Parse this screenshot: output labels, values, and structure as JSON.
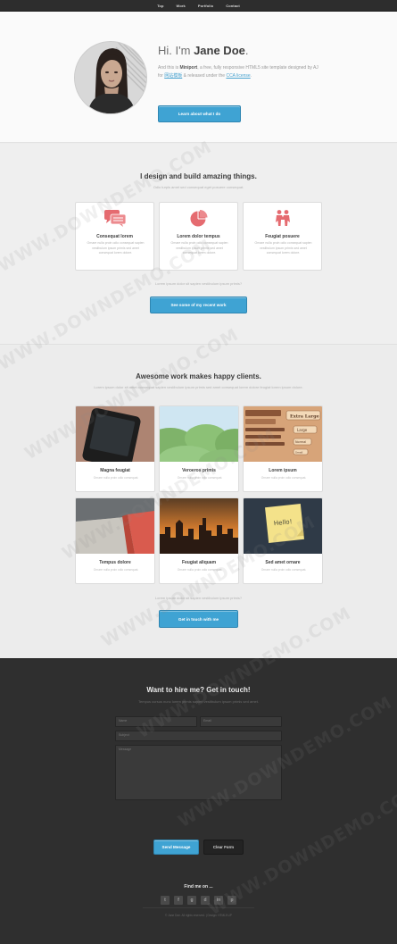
{
  "nav": {
    "items": [
      "Top",
      "Work",
      "Portfolio",
      "Contact"
    ]
  },
  "hero": {
    "greeting": "Hi. I'm",
    "name": "Jane Doe",
    "period": ".",
    "text_pre": "And this is",
    "brand": "Miniport",
    "text_mid": ", a free, fully responsive HTML5 site template designed by AJ for",
    "link1": "网站模板",
    "text_post": "& released under the",
    "link2": "CCA license",
    "text_end": ".",
    "button": "Learn about what I do"
  },
  "services": {
    "title": "I design and build amazing things.",
    "subtitle": "Odio turpis amet sed consequat eget posuere consequat.",
    "items": [
      {
        "icon": "comments-icon",
        "name": "Consequat lorem",
        "desc": "Ornare nulla proin odio consequat sapien vestibulum ipsum primis sed amet consequat lorem dolore."
      },
      {
        "icon": "pie-chart-icon",
        "name": "Lorem dolor tempus",
        "desc": "Ornare nulla proin odio consequat sapien vestibulum ipsum primis sed amet consequat lorem dolore."
      },
      {
        "icon": "people-icon",
        "name": "Feugiat posuere",
        "desc": "Ornare nulla proin odio consequat sapien vestibulum ipsum primis sed amet consequat lorem dolore."
      }
    ],
    "note": "Lorem ipsum dolor sit sapien vestibulum ipsum primis?",
    "button": "See some of my recent work"
  },
  "portfolio": {
    "title": "Awesome work makes happy clients.",
    "subtitle": "Lorem ipsum dolor sit amet consequat sapien vestibulum ipsum primis sed amet consequat lorem dolore feugiat lorem ipsum dolore.",
    "items": [
      {
        "title": "Magna feugiat",
        "desc": "Ornare nulla proin odio consequat."
      },
      {
        "title": "Veroeros primis",
        "desc": "Ornare nulla proin odio consequat."
      },
      {
        "title": "Lorem ipsum",
        "desc": "Ornare nulla proin odio consequat."
      },
      {
        "title": "Tempus dolore",
        "desc": "Ornare nulla proin odio consequat."
      },
      {
        "title": "Feugiat aliquam",
        "desc": "Ornare nulla proin odio consequat."
      },
      {
        "title": "Sed amet ornare",
        "desc": "Ornare nulla proin odio consequat."
      }
    ],
    "thumb3_labels": [
      "Extra Large",
      "Large",
      "Normal",
      "Small"
    ],
    "thumb6_label": "Hello!",
    "note": "Lorem ipsum dolor sit sapien vestibulum ipsum primis?",
    "button": "Get in touch with me"
  },
  "contact": {
    "title": "Want to hire me? Get in touch!",
    "subtitle": "Tempus cursus nunc lorem primis sapien vestibulum ipsum primis sed amet.",
    "name_placeholder": "Name",
    "email_placeholder": "Email",
    "subject_placeholder": "Subject",
    "message_placeholder": "Message",
    "send": "Send Message",
    "clear": "Clear Form",
    "find_title": "Find me on ...",
    "social": [
      "t",
      "f",
      "g",
      "d",
      "in",
      "p"
    ],
    "social_icons": [
      "twitter-icon",
      "facebook-icon",
      "google-icon",
      "dribbble-icon",
      "linkedin-icon",
      "pinterest-icon"
    ],
    "copyright": "© Jane Doe. All rights reserved. | Design: HTML5 UP"
  },
  "watermark": "WWW.DOWNDEMO.COM",
  "colors": {
    "accent": "#3fa3d3",
    "icon_accent": "#e56b70",
    "dark": "#2f2f2f"
  }
}
